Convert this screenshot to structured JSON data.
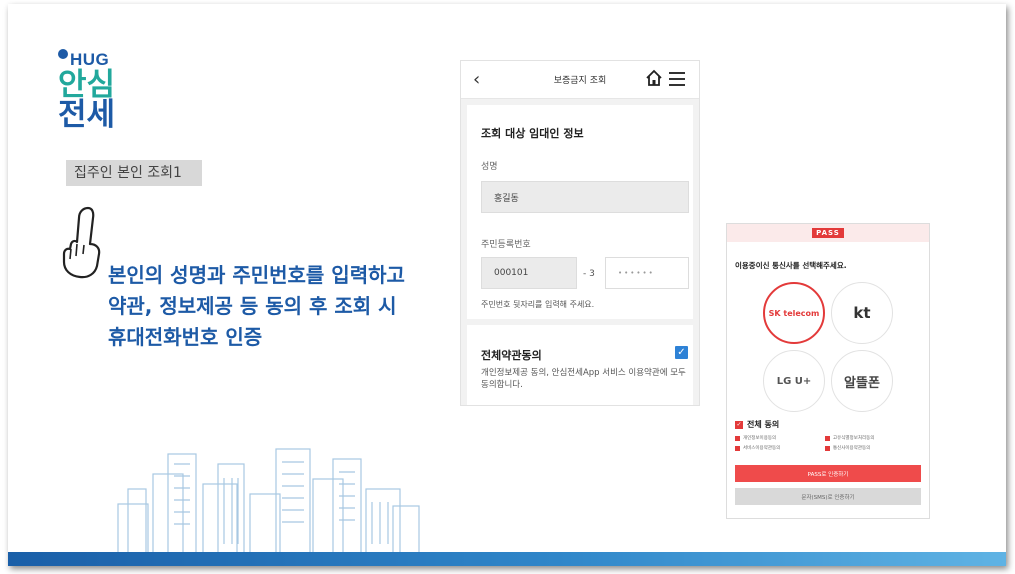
{
  "logo": {
    "brand": "HUG",
    "line1": "안심",
    "line2": "전세"
  },
  "subtitle": "집주인 본인 조회1",
  "message": {
    "lines": [
      "본인의 성명과 주민번호를 입력하고",
      "약관, 정보제공 등 동의 후 조회 시",
      "휴대전화번호 인증"
    ]
  },
  "phone1": {
    "header": {
      "back_icon": "chevron-left-icon",
      "title": "보증금지 조회",
      "home_icon": "home-icon",
      "menu_icon": "menu-icon"
    },
    "section_title": "조회 대상 임대인 정보",
    "name_label": "성명",
    "name_value": "홍길동",
    "rrn_label": "주민등록번호",
    "rrn_front": "000101",
    "rrn_separator": "- 3",
    "rrn_back_placeholder": "••••••",
    "rrn_hint": "주민번호 뒷자리를 입력해 주세요.",
    "agree_title": "전체약관동의",
    "agree_checked": true,
    "agree_desc": "개인정보제공 동의, 안심전세App 서비스 이용약관에 모두 동의합니다."
  },
  "phone2": {
    "logo": "PASS",
    "prompt": "이용중이신 통신사를 선택해주세요.",
    "carriers": [
      {
        "name": "SK telecom",
        "selected": true
      },
      {
        "name": "kt",
        "selected": false
      },
      {
        "name": "LG U+",
        "selected": false
      },
      {
        "name": "알뜰폰",
        "selected": false
      }
    ],
    "all_agree": "전체 동의",
    "terms": [
      "개인정보이용동의",
      "고유식별정보처리동의",
      "서비스이용약관동의",
      "통신사이용약관동의"
    ],
    "pass_button": "PASS로 인증하기",
    "sms_button": "문자(SMS)로 인증하기"
  },
  "colors": {
    "brand_blue": "#1d5aa6",
    "brand_teal": "#22a89c",
    "check_blue": "#2e82d6",
    "pass_red": "#e33a3a"
  }
}
